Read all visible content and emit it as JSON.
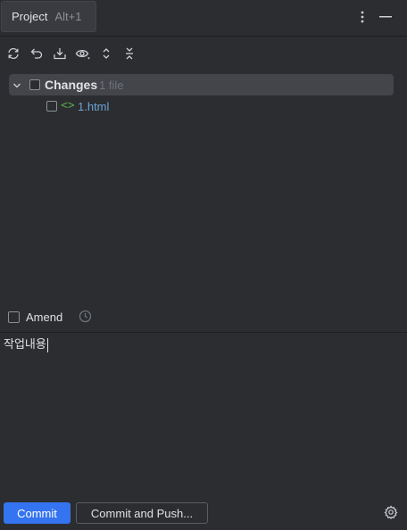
{
  "tab": {
    "title": "Project",
    "shortcut": "Alt+1"
  },
  "header": {
    "icons": [
      "more-vertical-icon",
      "minimize-icon"
    ]
  },
  "toolbar": {
    "icons": [
      "refresh-icon",
      "rollback-icon",
      "shelve-icon",
      "preview-eye-icon",
      "expand-all-icon",
      "collapse-all-icon"
    ]
  },
  "changes": {
    "label": "Changes",
    "count": "1 file",
    "files": [
      {
        "icon": "<>",
        "name": "1.html"
      }
    ]
  },
  "amend": {
    "label": "Amend"
  },
  "commit_message": "작업내용",
  "buttons": {
    "commit": "Commit",
    "commit_push": "Commit and Push..."
  },
  "colors": {
    "accent": "#3574f0",
    "background": "#2b2d30",
    "file_name": "#6ea2d6",
    "file_icon": "#57a64a"
  }
}
